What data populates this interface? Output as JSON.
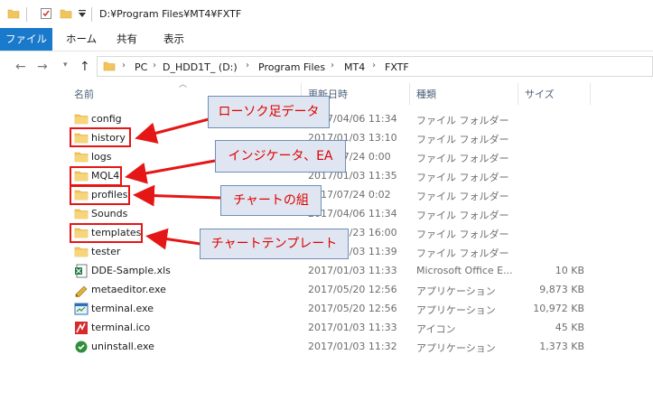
{
  "window": {
    "path": "D:¥Program Files¥MT4¥FXTF"
  },
  "ribbon": {
    "tabs": [
      "ファイル",
      "ホーム",
      "共有",
      "表示"
    ]
  },
  "breadcrumb": [
    "PC",
    "D_HDD1T_ (D:)",
    "Program Files",
    "MT4",
    "FXTF"
  ],
  "columns": {
    "name": "名前",
    "date": "更新日時",
    "type": "種類",
    "size": "サイズ"
  },
  "files": [
    {
      "name": "config",
      "date": "2017/04/06 11:34",
      "type": "ファイル フォルダー",
      "size": "",
      "icon": "folder-icon"
    },
    {
      "name": "history",
      "date": "2017/01/03 13:10",
      "type": "ファイル フォルダー",
      "size": "",
      "icon": "folder-icon"
    },
    {
      "name": "logs",
      "date": "2017/07/24 0:00",
      "type": "ファイル フォルダー",
      "size": "",
      "icon": "folder-icon"
    },
    {
      "name": "MQL4",
      "date": "2017/01/03 11:35",
      "type": "ファイル フォルダー",
      "size": "",
      "icon": "folder-icon"
    },
    {
      "name": "profiles",
      "date": "2017/07/24 0:02",
      "type": "ファイル フォルダー",
      "size": "",
      "icon": "folder-icon"
    },
    {
      "name": "Sounds",
      "date": "2017/04/06 11:34",
      "type": "ファイル フォルダー",
      "size": "",
      "icon": "folder-icon"
    },
    {
      "name": "templates",
      "date": "2017/07/23 16:00",
      "type": "ファイル フォルダー",
      "size": "",
      "icon": "folder-icon"
    },
    {
      "name": "tester",
      "date": "2017/01/03 11:39",
      "type": "ファイル フォルダー",
      "size": "",
      "icon": "folder-icon"
    },
    {
      "name": "DDE-Sample.xls",
      "date": "2017/01/03 11:33",
      "type": "Microsoft Office E...",
      "size": "10 KB",
      "icon": "excel-file-icon"
    },
    {
      "name": "metaeditor.exe",
      "date": "2017/05/20 12:56",
      "type": "アプリケーション",
      "size": "9,873 KB",
      "icon": "metaeditor-app-icon"
    },
    {
      "name": "terminal.exe",
      "date": "2017/05/20 12:56",
      "type": "アプリケーション",
      "size": "10,972 KB",
      "icon": "terminal-app-icon"
    },
    {
      "name": "terminal.ico",
      "date": "2017/01/03 11:33",
      "type": "アイコン",
      "size": "45 KB",
      "icon": "terminal-ico-icon"
    },
    {
      "name": "uninstall.exe",
      "date": "2017/01/03 11:32",
      "type": "アプリケーション",
      "size": "1,373 KB",
      "icon": "uninstall-app-icon"
    }
  ],
  "annotations": [
    {
      "label": "ローソク足データ",
      "target": "history"
    },
    {
      "label": "インジケータ、EA",
      "target": "MQL4"
    },
    {
      "label": "チャートの組",
      "target": "profiles"
    },
    {
      "label": "チャートテンプレート",
      "target": "templates"
    }
  ],
  "colors": {
    "accent": "#1979ca",
    "annotation_red": "#e51616",
    "callout_fill": "#dfe6f1",
    "folder": "#f2c55c"
  }
}
